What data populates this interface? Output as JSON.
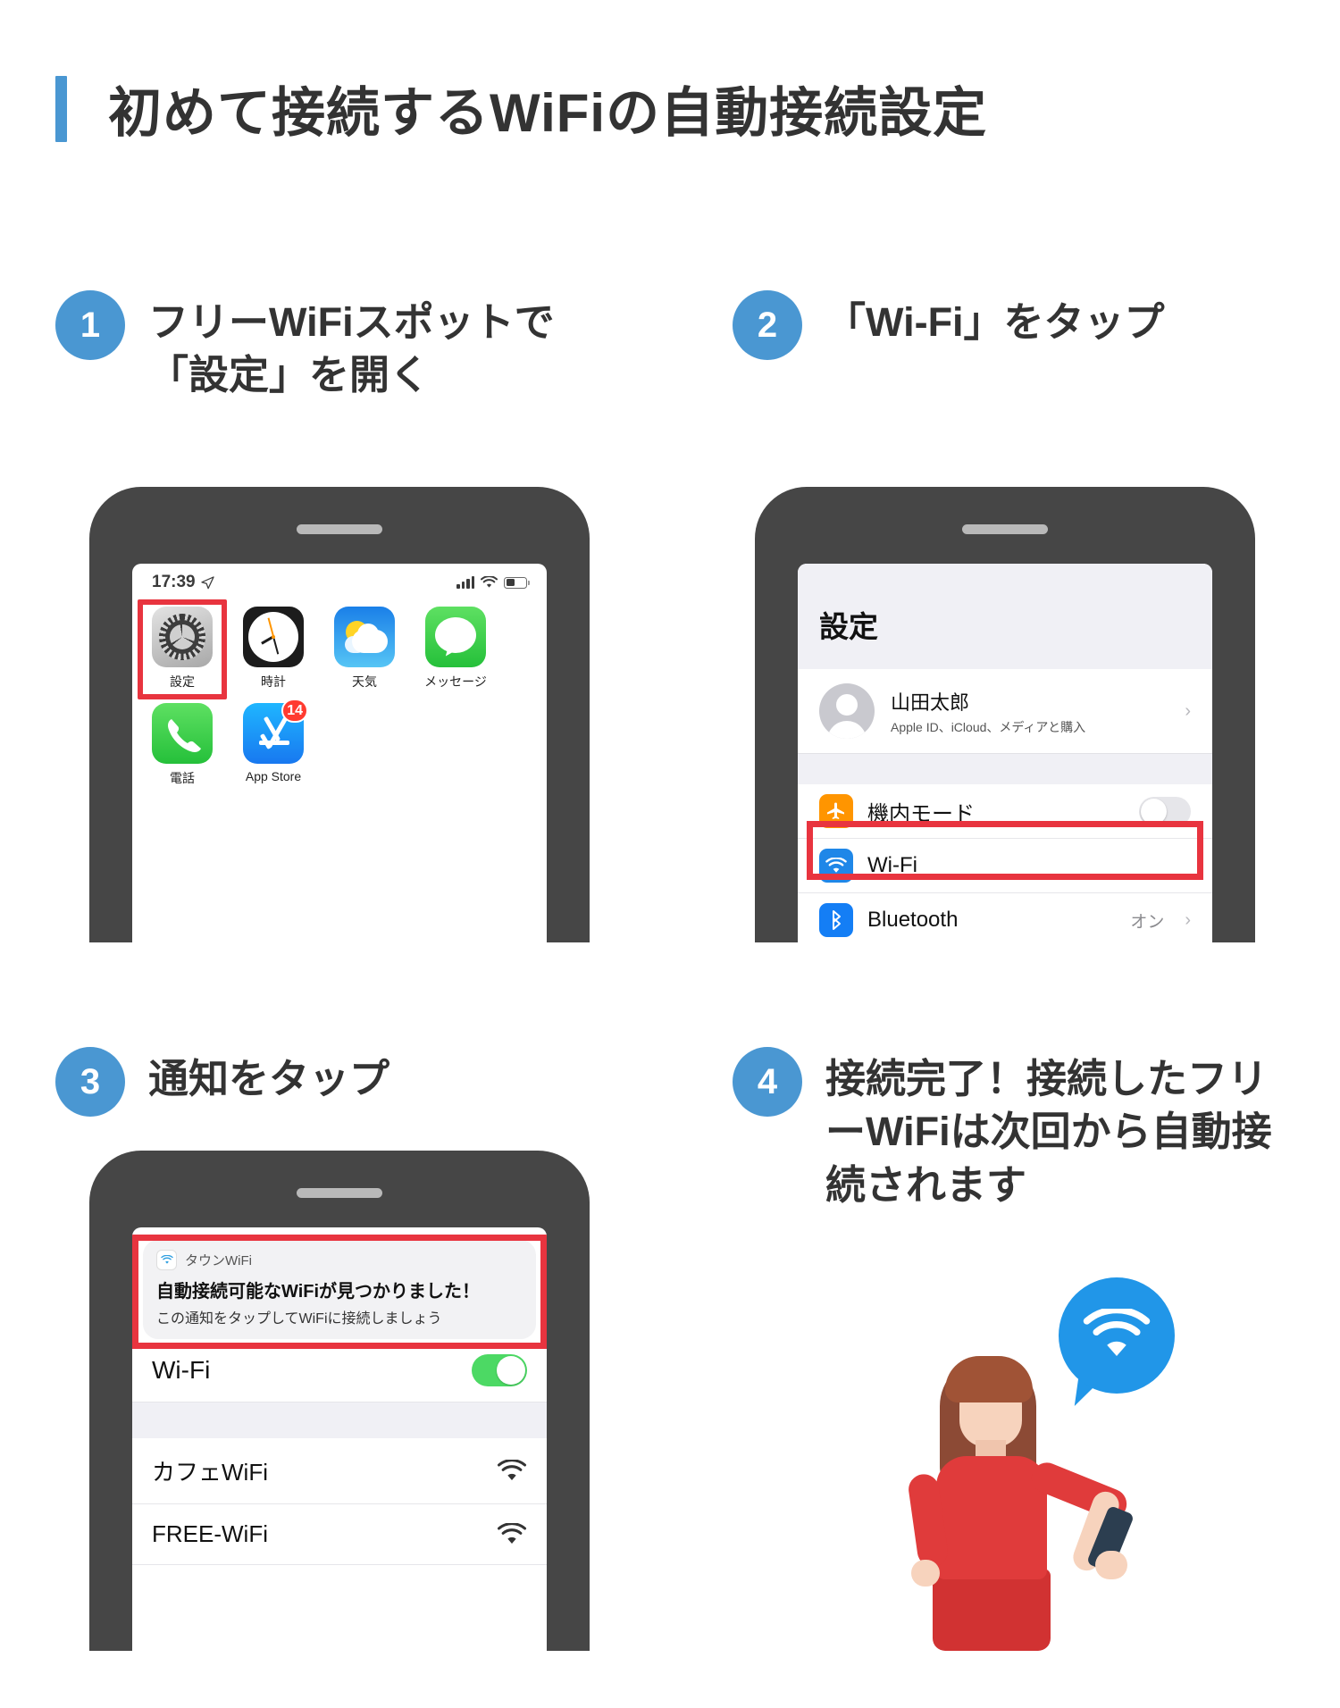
{
  "title": "初めて接続するWiFiの自動接続設定",
  "accent_color": "#4a97d2",
  "highlight_color": "#e8343f",
  "steps": [
    {
      "number": "1",
      "text": "フリーWiFiスポットで「設定」を開く"
    },
    {
      "number": "2",
      "text": "「Wi-Fi」をタップ"
    },
    {
      "number": "3",
      "text": "通知をタップ"
    },
    {
      "number": "4",
      "text": "接続完了！接続したフリーWiFiは次回から自動接続されます"
    }
  ],
  "phone1": {
    "statusbar": {
      "time": "17:39",
      "location_icon": "location-arrow-icon",
      "signal_icon": "cellular-signal-icon",
      "wifi_icon": "wifi-icon",
      "battery_icon": "battery-icon"
    },
    "apps_row1": [
      {
        "label": "設定",
        "icon": "settings-gear-icon",
        "highlighted": true
      },
      {
        "label": "時計",
        "icon": "clock-icon",
        "highlighted": false
      },
      {
        "label": "天気",
        "icon": "weather-icon",
        "highlighted": false
      },
      {
        "label": "メッセージ",
        "icon": "messages-icon",
        "highlighted": false
      }
    ],
    "apps_row2": [
      {
        "label": "電話",
        "icon": "phone-icon",
        "badge": ""
      },
      {
        "label": "App Store",
        "icon": "app-store-icon",
        "badge": "14"
      }
    ]
  },
  "phone2": {
    "title": "設定",
    "account": {
      "name": "山田太郎",
      "subtitle": "Apple ID、iCloud、メディアと購入",
      "chevron": "›"
    },
    "rows": [
      {
        "label": "機内モード",
        "icon": "airplane-icon",
        "control": "toggle-off",
        "value": ""
      },
      {
        "label": "Wi-Fi",
        "icon": "wifi-icon",
        "control": "none",
        "value": "",
        "highlighted": true
      },
      {
        "label": "Bluetooth",
        "icon": "bluetooth-icon",
        "control": "chevron",
        "value": "オン",
        "chevron": "›"
      }
    ]
  },
  "phone3": {
    "notification": {
      "app_name": "タウンWiFi",
      "app_icon": "wifi-icon",
      "title": "自動接続可能なWiFiが見つかりました！",
      "body": "この通知をタップしてWiFiに接続しましょう",
      "highlighted": true
    },
    "wifi_toggle_row": {
      "label": "Wi-Fi",
      "state": "on"
    },
    "networks": [
      {
        "name": "カフェWiFi",
        "icon": "wifi-signal-icon"
      },
      {
        "name": "FREE-WiFi",
        "icon": "wifi-signal-icon"
      }
    ]
  },
  "illustration": {
    "bubble_icon": "wifi-icon",
    "bubble_color": "#2196e8",
    "person": "woman-holding-smartphone"
  }
}
